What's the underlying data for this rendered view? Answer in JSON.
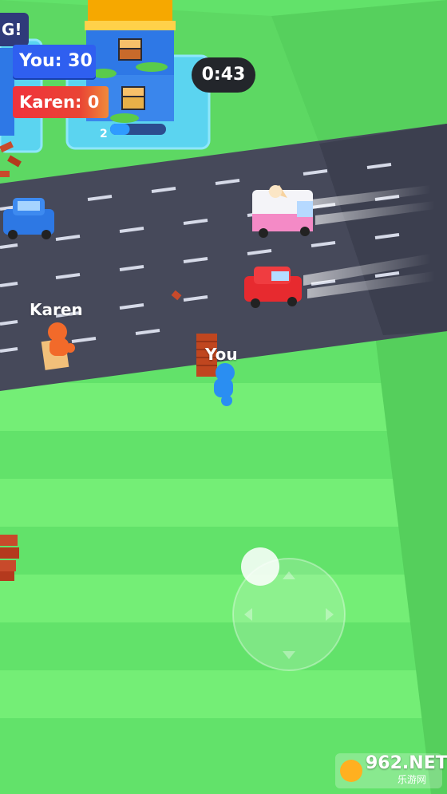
{
  "hud": {
    "banner_text": "G!",
    "you_score": "You: 30",
    "karen_score": "Karen: 0",
    "timer": "0:43"
  },
  "players": {
    "karen_label": "Karen",
    "you_label": "You"
  },
  "building": {
    "level": "2",
    "progress_fraction": 0.35
  },
  "watermark": {
    "main": "962.NET",
    "sub": "乐游网"
  },
  "colors": {
    "grass_light": "#79f27c",
    "grass_dark": "#5fd966",
    "road": "#46495a",
    "you_blue": "#2f5ff0",
    "karen_red": "#f0323c",
    "timer_bg": "#23262b"
  }
}
